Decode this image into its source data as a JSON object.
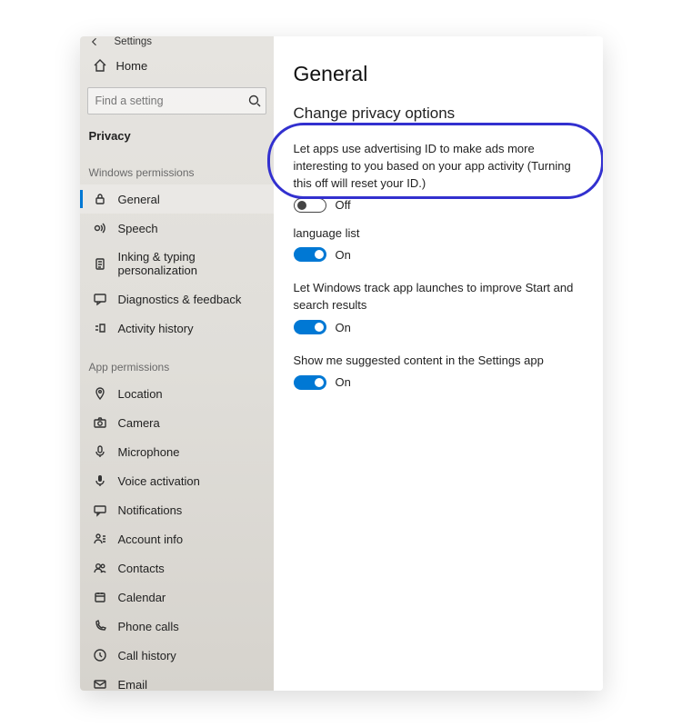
{
  "titlebar": {
    "label": "Settings"
  },
  "home": {
    "label": "Home"
  },
  "search": {
    "placeholder": "Find a setting"
  },
  "category": {
    "label": "Privacy"
  },
  "sections": {
    "windows_permissions": {
      "label": "Windows permissions",
      "items": [
        {
          "label": "General",
          "icon": "lock-icon",
          "active": true
        },
        {
          "label": "Speech",
          "icon": "speech-icon"
        },
        {
          "label": "Inking & typing personalization",
          "icon": "clipboard-icon"
        },
        {
          "label": "Diagnostics & feedback",
          "icon": "feedback-icon"
        },
        {
          "label": "Activity history",
          "icon": "history-icon"
        }
      ]
    },
    "app_permissions": {
      "label": "App permissions",
      "items": [
        {
          "label": "Location",
          "icon": "location-icon"
        },
        {
          "label": "Camera",
          "icon": "camera-icon"
        },
        {
          "label": "Microphone",
          "icon": "microphone-icon"
        },
        {
          "label": "Voice activation",
          "icon": "voice-icon"
        },
        {
          "label": "Notifications",
          "icon": "notification-icon"
        },
        {
          "label": "Account info",
          "icon": "account-icon"
        },
        {
          "label": "Contacts",
          "icon": "contacts-icon"
        },
        {
          "label": "Calendar",
          "icon": "calendar-icon"
        },
        {
          "label": "Phone calls",
          "icon": "phone-icon"
        },
        {
          "label": "Call history",
          "icon": "callhistory-icon"
        },
        {
          "label": "Email",
          "icon": "email-icon"
        }
      ]
    }
  },
  "main": {
    "title": "General",
    "subtitle": "Change privacy options",
    "settings": [
      {
        "desc": "Let apps use advertising ID to make ads more interesting to you based on your app activity (Turning this off will reset your ID.)",
        "state": "off",
        "state_label": "Off",
        "highlighted": true
      },
      {
        "desc": "language list",
        "desc_clipped": true,
        "state": "on",
        "state_label": "On"
      },
      {
        "desc": "Let Windows track app launches to improve Start and search results",
        "state": "on",
        "state_label": "On"
      },
      {
        "desc": "Show me suggested content in the Settings app",
        "state": "on",
        "state_label": "On"
      }
    ]
  }
}
